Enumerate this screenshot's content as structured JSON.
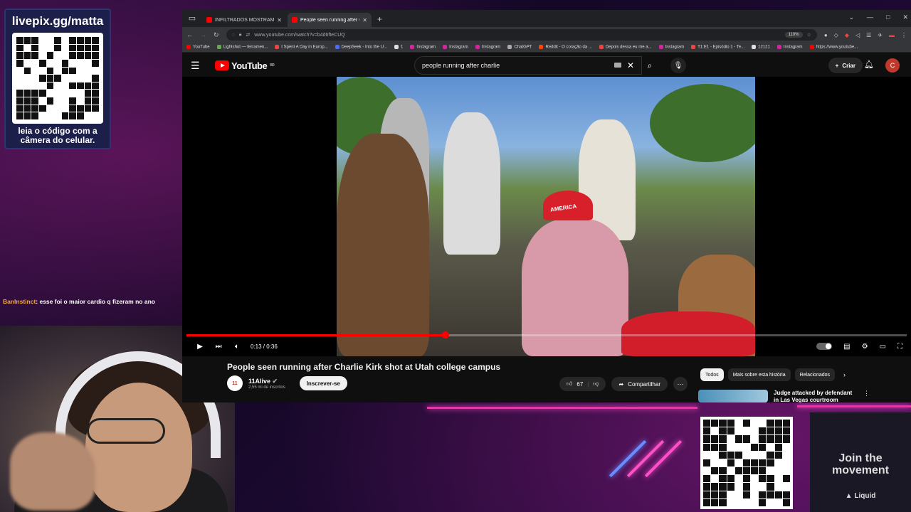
{
  "overlay": {
    "qr_title": "livepix.gg/matta",
    "qr_caption": "leia o código com a câmera do celular.",
    "chat_user": "BanInstinct",
    "chat_message": ": esse foi o maior cardio q fizeram no ano",
    "join_text": "Join the movement",
    "brand": "Liquid"
  },
  "browser": {
    "tabs": [
      {
        "label": "INFILTRADOS MOSTRAM IGNO",
        "active": false
      },
      {
        "label": "People seen running after Char",
        "active": true
      }
    ],
    "url": "www.youtube.com/watch?v=b4d6fteCUQ",
    "zoom": "110%",
    "bookmarks": [
      "YouTube",
      "Lightshot — ferramen...",
      "I Spent A Day in Europ...",
      "DeepSeek - Into the U...",
      "1",
      "Instagram",
      "Instagram",
      "Instagram",
      "ChatGPT",
      "Reddit - O coração da ...",
      "Depois dessa eu me a...",
      "Instagram",
      "T1:E1 - Episódio 1 - Te...",
      "12121",
      "Instagram",
      "https://www.youtube..."
    ]
  },
  "youtube": {
    "logo": "YouTube",
    "region": "BR",
    "search_query": "people running after charlie",
    "create_label": "Criar",
    "avatar_letter": "C",
    "time": "0:13 / 0:36",
    "progress": 0.36,
    "video_title": "People seen running after Charlie Kirk shot at Utah college campus",
    "channel_name": "11Alive",
    "subscribers": "2,55 mi de inscritos",
    "subscribe_label": "Inscrever-se",
    "likes": "67",
    "share_label": "Compartilhar",
    "chips": [
      "Todos",
      "Mais sobre esta história",
      "Relacionados"
    ],
    "rec_title": "Judge attacked by defendant in Las Vegas courtroom"
  },
  "colors": {
    "accent": "#ff0000",
    "overlay_pink": "#e03aa8"
  }
}
